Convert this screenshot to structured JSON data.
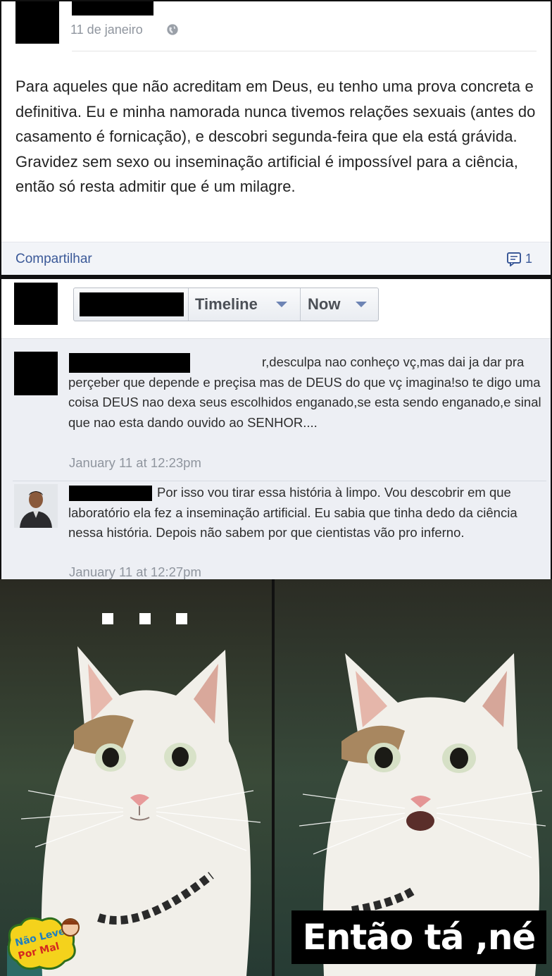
{
  "post": {
    "date": "11 de janeiro",
    "audience_icon": "globe-icon",
    "text": "Para aqueles que não acreditam em Deus, eu tenho uma prova concreta e definitiva. Eu e minha namorada nunca tivemos relações sexuais (antes do casamento é fornicação), e descobri segunda-feira que ela está grávida. Gravidez sem sexo ou inseminação artificial é impossível para a ciência, então só resta admitir que é um milagre.",
    "share_label": "Compartilhar",
    "comment_icon": "comment-icon",
    "comment_count": "1"
  },
  "timeline": {
    "view_label": "Timeline",
    "sort_label": "Now",
    "comments": [
      {
        "text": "r,desculpa nao conheço vç,mas dai ja dar pra perçeber que depende e preçisa mas de DEUS do que vç imagina!so te digo uma coisa DEUS nao dexa seus escolhidos enganado,se esta sendo enganado,e sinal que nao esta dando ouvido ao SENHOR....",
        "time": "January 11 at 12:23pm"
      },
      {
        "text": "Por isso vou tirar essa história à limpo. Vou descobrir em que laboratório ela fez a inseminação artificial. Eu sabia que tinha dedo da ciência nessa história. Depois não sabem por que cientistas vão pro inferno.",
        "time": "January 11 at 12:27pm"
      }
    ]
  },
  "meme": {
    "caption": "Então tá ,né",
    "logo_text": "Não Leve Por Mal"
  },
  "colors": {
    "link": "#3b5998",
    "muted": "#8f959e",
    "comment_bg": "#edeff4"
  }
}
